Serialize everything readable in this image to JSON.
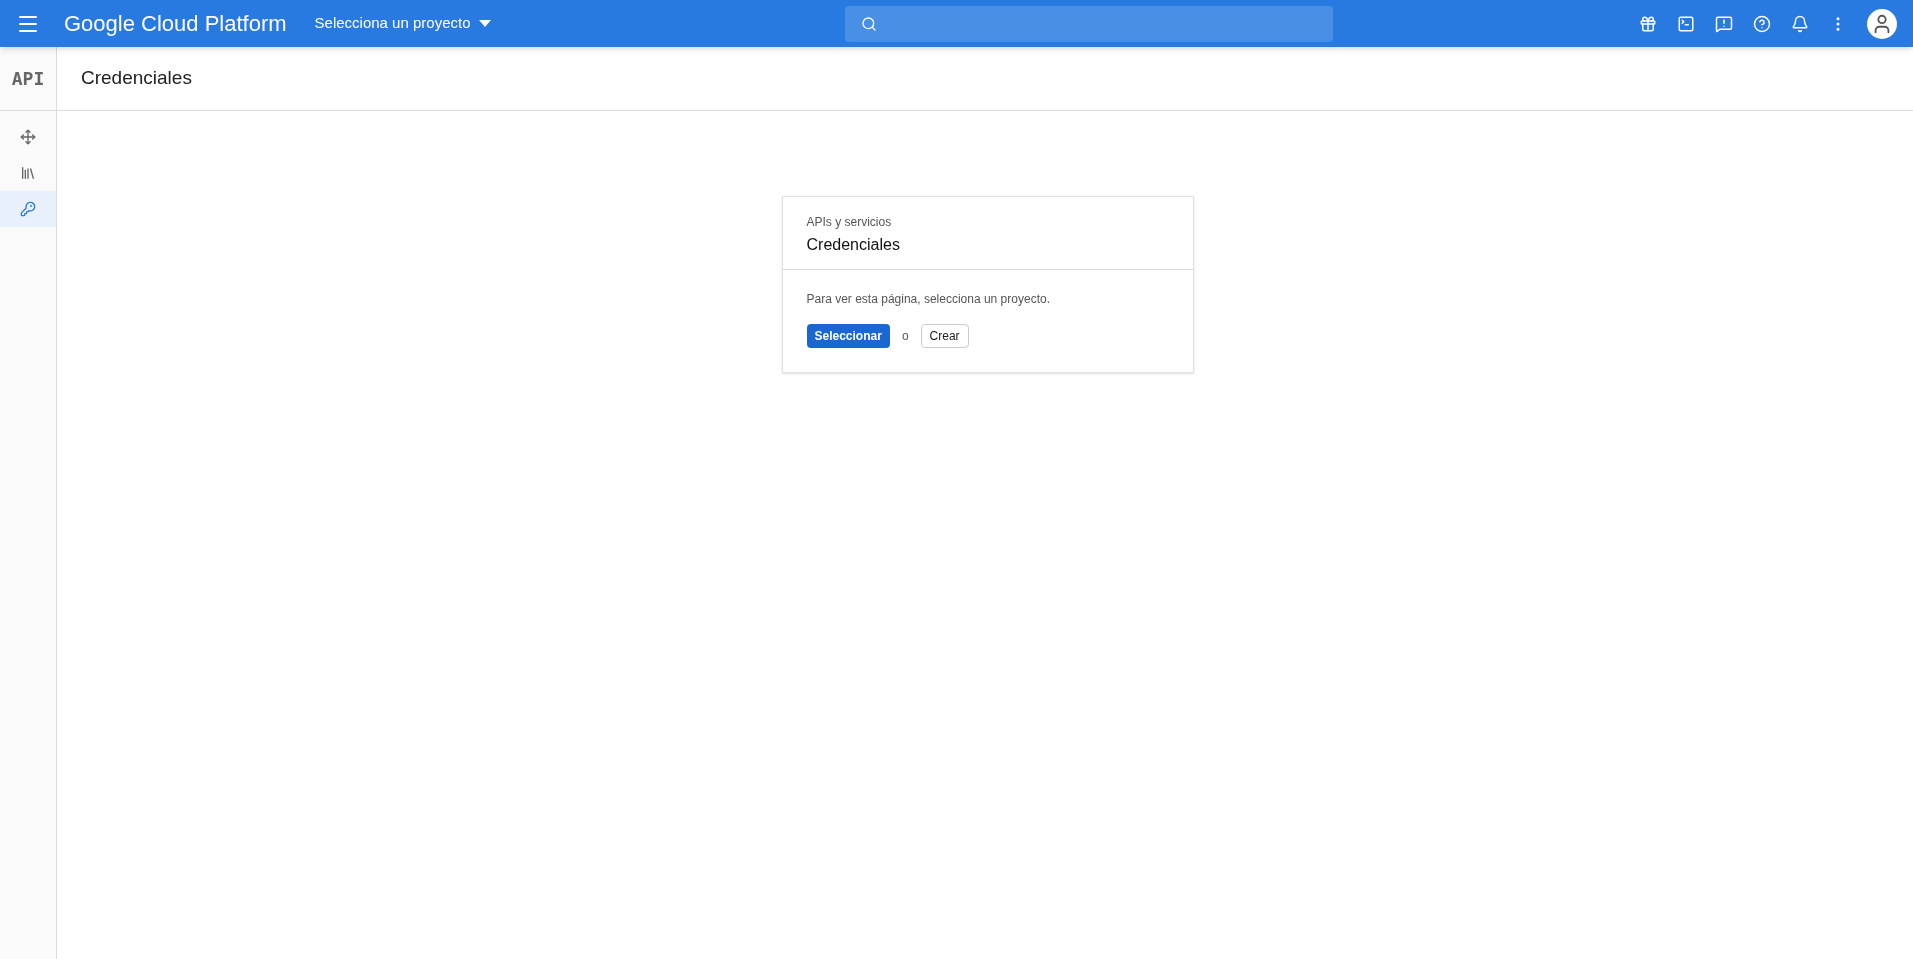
{
  "top_bar": {
    "product": "Google Cloud Platform",
    "project_picker": "Selecciona un proyecto"
  },
  "sidebar": {
    "logo": "API",
    "items": [
      {
        "kind": "dashboard",
        "selected": false
      },
      {
        "kind": "library",
        "selected": false
      },
      {
        "kind": "credentials",
        "selected": true
      }
    ]
  },
  "page": {
    "title": "Credenciales"
  },
  "card": {
    "overline": "APIs y servicios",
    "title": "Credenciales",
    "message": "Para ver esta página, selecciona un proyecto.",
    "primary_button": "Seleccionar",
    "separator": "o",
    "secondary_button": "Crear"
  }
}
